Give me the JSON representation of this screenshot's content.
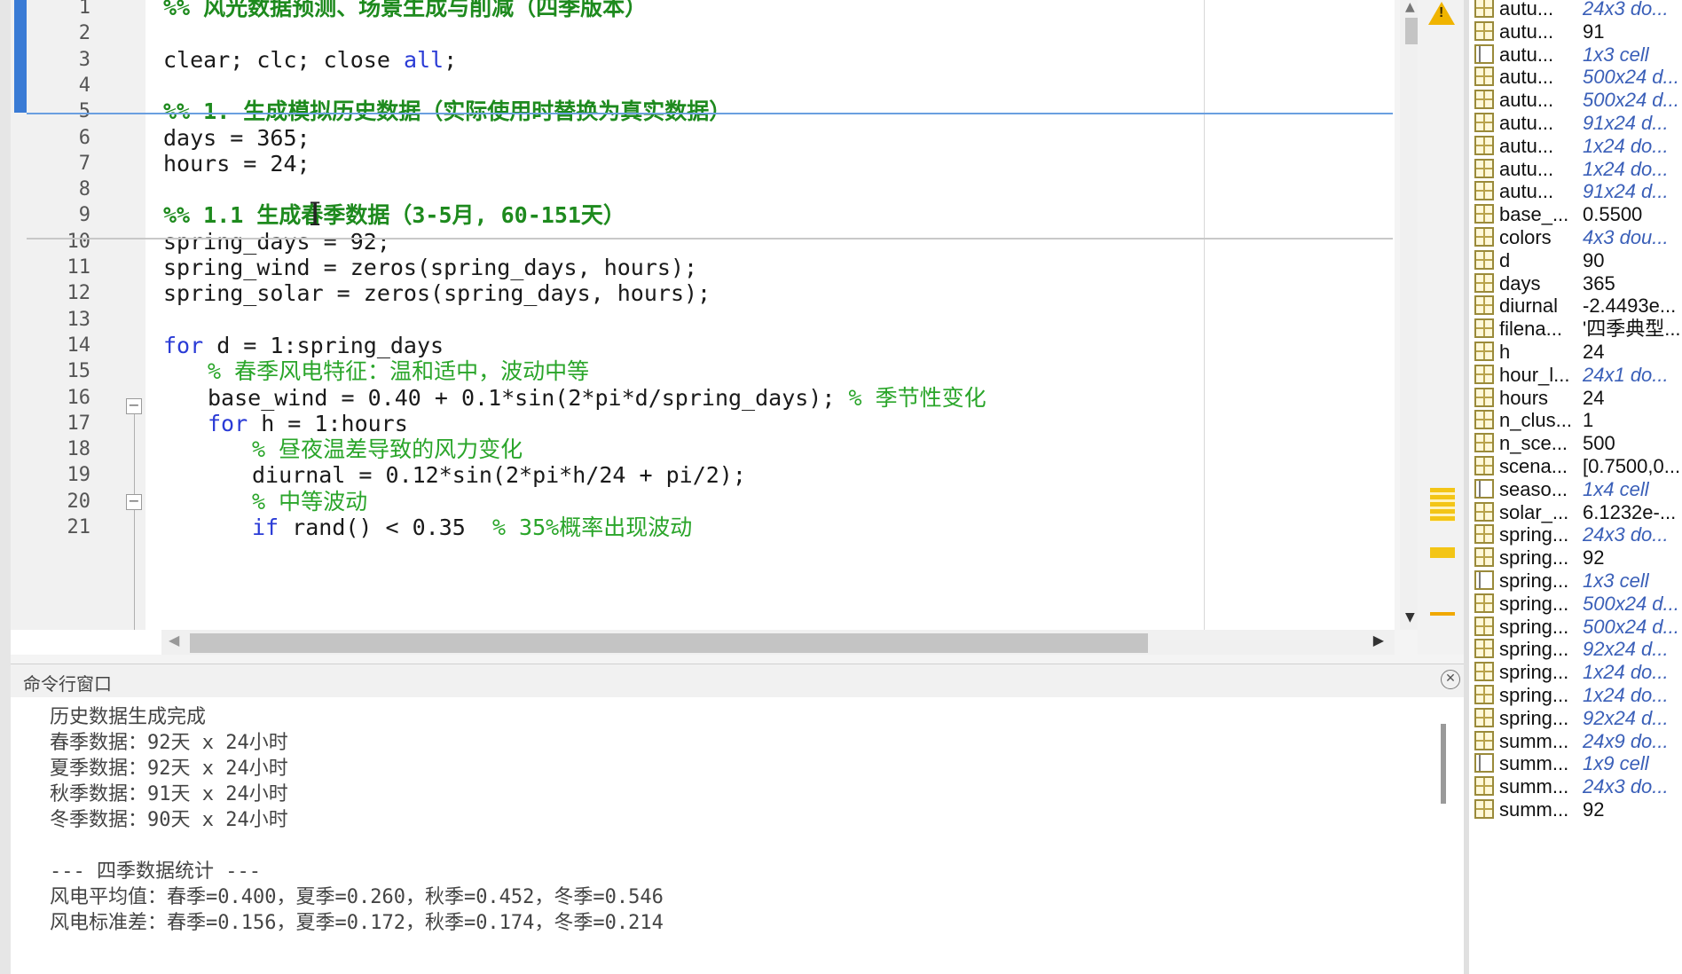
{
  "editor": {
    "lines": [
      {
        "n": "1",
        "text": "%% 风光数据预测、场景生成与削减（四季版本）",
        "kind": "sec"
      },
      {
        "n": "2",
        "text": "",
        "kind": "code"
      },
      {
        "n": "3",
        "text": "clear; clc; close ",
        "kw2": "all",
        "tail": ";",
        "kind": "code"
      },
      {
        "n": "4",
        "text": "",
        "kind": "code"
      },
      {
        "n": "5",
        "text": "%% 1. 生成模拟历史数据（实际使用时替换为真实数据）",
        "kind": "sec"
      },
      {
        "n": "6",
        "text": "days = 365;",
        "kind": "code"
      },
      {
        "n": "7",
        "text": "hours = 24;",
        "kind": "code"
      },
      {
        "n": "8",
        "text": "",
        "kind": "code"
      },
      {
        "n": "9",
        "text": "%% 1.1 生成春季数据（3-5月, 60-151天）",
        "kind": "sec"
      },
      {
        "n": "10",
        "text": "spring_days = 92;",
        "kind": "code"
      },
      {
        "n": "11",
        "text": "spring_wind = zeros(spring_days, hours);",
        "kind": "code"
      },
      {
        "n": "12",
        "text": "spring_solar = zeros(spring_days, hours);",
        "kind": "code"
      },
      {
        "n": "13",
        "text": "",
        "kind": "code"
      },
      {
        "n": "14",
        "kw": "for",
        "text": " d = 1:spring_days",
        "kind": "kwline",
        "indent": 0
      },
      {
        "n": "15",
        "text": "% 春季风电特征：温和适中，波动中等",
        "kind": "com",
        "indent": 1
      },
      {
        "n": "16",
        "text": "base_wind = 0.40 + 0.1*sin(2*pi*d/spring_days); ",
        "tailcom": "% 季节性变化",
        "kind": "codecom",
        "indent": 1
      },
      {
        "n": "17",
        "kw": "for",
        "text": " h = 1:hours",
        "kind": "kwline",
        "indent": 1
      },
      {
        "n": "18",
        "text": "% 昼夜温差导致的风力变化",
        "kind": "com",
        "indent": 2
      },
      {
        "n": "19",
        "text": "diurnal = 0.12*sin(2*pi*h/24 + pi/2);",
        "kind": "code",
        "indent": 2
      },
      {
        "n": "20",
        "text": "% 中等波动",
        "kind": "com",
        "indent": 2
      },
      {
        "n": "21",
        "kw": "if",
        "text": " rand() < 0.35  ",
        "tailcom": "% 35%概率出现波动",
        "kind": "kwcom",
        "indent": 2
      }
    ]
  },
  "command_window": {
    "title": "命令行窗口",
    "lines": [
      "历史数据生成完成",
      "春季数据：92天 x 24小时",
      "夏季数据：92天 x 24小时",
      "秋季数据：91天 x 24小时",
      "冬季数据：90天 x 24小时",
      "",
      "--- 四季数据统计 ---",
      "风电平均值：春季=0.400，夏季=0.260，秋季=0.452，冬季=0.546",
      "风电标准差：春季=0.156，夏季=0.172，秋季=0.174，冬季=0.214"
    ]
  },
  "workspace": {
    "rows": [
      {
        "name": "autu...",
        "value": "24x3 do...",
        "dim": true,
        "icon": "matrix"
      },
      {
        "name": "autu...",
        "value": "91",
        "dim": false,
        "icon": "matrix"
      },
      {
        "name": "autu...",
        "value": "1x3 cell",
        "dim": true,
        "icon": "cell"
      },
      {
        "name": "autu...",
        "value": "500x24 d...",
        "dim": true,
        "icon": "matrix"
      },
      {
        "name": "autu...",
        "value": "500x24 d...",
        "dim": true,
        "icon": "matrix"
      },
      {
        "name": "autu...",
        "value": "91x24 d...",
        "dim": true,
        "icon": "matrix"
      },
      {
        "name": "autu...",
        "value": "1x24 do...",
        "dim": true,
        "icon": "matrix"
      },
      {
        "name": "autu...",
        "value": "1x24 do...",
        "dim": true,
        "icon": "matrix"
      },
      {
        "name": "autu...",
        "value": "91x24 d...",
        "dim": true,
        "icon": "matrix"
      },
      {
        "name": "base_...",
        "value": "0.5500",
        "dim": false,
        "icon": "matrix"
      },
      {
        "name": "colors",
        "value": "4x3 dou...",
        "dim": true,
        "icon": "matrix"
      },
      {
        "name": "d",
        "value": "90",
        "dim": false,
        "icon": "matrix"
      },
      {
        "name": "days",
        "value": "365",
        "dim": false,
        "icon": "matrix"
      },
      {
        "name": "diurnal",
        "value": "-2.4493e...",
        "dim": false,
        "icon": "matrix"
      },
      {
        "name": "filena...",
        "value": "'四季典型...",
        "dim": false,
        "icon": "matrix"
      },
      {
        "name": "h",
        "value": "24",
        "dim": false,
        "icon": "matrix"
      },
      {
        "name": "hour_l...",
        "value": "24x1 do...",
        "dim": true,
        "icon": "matrix"
      },
      {
        "name": "hours",
        "value": "24",
        "dim": false,
        "icon": "matrix"
      },
      {
        "name": "n_clus...",
        "value": "1",
        "dim": false,
        "icon": "matrix"
      },
      {
        "name": "n_sce...",
        "value": "500",
        "dim": false,
        "icon": "matrix"
      },
      {
        "name": "scena...",
        "value": "[0.7500,0...",
        "dim": false,
        "icon": "matrix"
      },
      {
        "name": "seaso...",
        "value": "1x4 cell",
        "dim": true,
        "icon": "cell"
      },
      {
        "name": "solar_...",
        "value": "6.1232e-...",
        "dim": false,
        "icon": "matrix"
      },
      {
        "name": "spring...",
        "value": "24x3 do...",
        "dim": true,
        "icon": "matrix"
      },
      {
        "name": "spring...",
        "value": "92",
        "dim": false,
        "icon": "matrix"
      },
      {
        "name": "spring...",
        "value": "1x3 cell",
        "dim": true,
        "icon": "cell"
      },
      {
        "name": "spring...",
        "value": "500x24 d...",
        "dim": true,
        "icon": "matrix"
      },
      {
        "name": "spring...",
        "value": "500x24 d...",
        "dim": true,
        "icon": "matrix"
      },
      {
        "name": "spring...",
        "value": "92x24 d...",
        "dim": true,
        "icon": "matrix"
      },
      {
        "name": "spring...",
        "value": "1x24 do...",
        "dim": true,
        "icon": "matrix"
      },
      {
        "name": "spring...",
        "value": "1x24 do...",
        "dim": true,
        "icon": "matrix"
      },
      {
        "name": "spring...",
        "value": "92x24 d...",
        "dim": true,
        "icon": "matrix"
      },
      {
        "name": "summ...",
        "value": "24x9 do...",
        "dim": true,
        "icon": "matrix"
      },
      {
        "name": "summ...",
        "value": "1x9 cell",
        "dim": true,
        "icon": "cell"
      },
      {
        "name": "summ...",
        "value": "24x3 do...",
        "dim": true,
        "icon": "matrix"
      },
      {
        "name": "summ...",
        "value": "92",
        "dim": false,
        "icon": "matrix"
      }
    ]
  },
  "icons": {
    "warning": "warning-icon",
    "close": "close-icon",
    "fold": "fold-toggle-icon"
  },
  "colors": {
    "section_comment": "#1e8a1e",
    "comment": "#2aa52a",
    "keyword": "#2a3bd6",
    "cell_bar": "#3a7bd5",
    "warning": "#f0b400"
  }
}
